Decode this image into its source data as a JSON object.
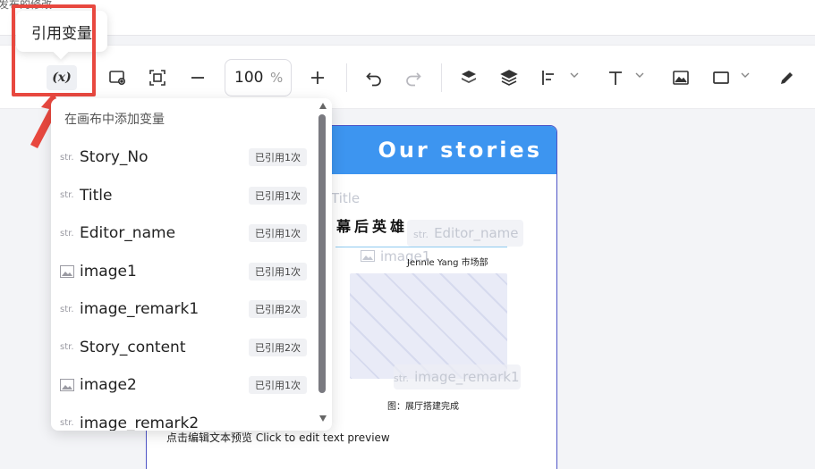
{
  "header": {
    "clipped_text": "发布的修改"
  },
  "tooltip": {
    "label": "引用变量"
  },
  "toolbar": {
    "variable_button_label": "(x)",
    "zoom_value": "100",
    "zoom_unit": "%"
  },
  "dropdown": {
    "heading": "在画布中添加变量",
    "items": [
      {
        "type": "str.",
        "name": "Story_No",
        "badge": "已引用1次"
      },
      {
        "type": "str.",
        "name": "Title",
        "badge": "已引用1次"
      },
      {
        "type": "str.",
        "name": "Editor_name",
        "badge": "已引用1次"
      },
      {
        "type": "image-icon",
        "name": "image1",
        "badge": "已引用1次"
      },
      {
        "type": "str.",
        "name": "image_remark1",
        "badge": "已引用2次"
      },
      {
        "type": "str.",
        "name": "Story_content",
        "badge": "已引用2次"
      },
      {
        "type": "image-icon",
        "name": "image2",
        "badge": "已引用1次"
      },
      {
        "type": "str.",
        "name": "image_remark2",
        "badge": ""
      }
    ]
  },
  "canvas": {
    "header_title": "Our stories",
    "ghost_title": "Title",
    "section_title": "幕后英雄",
    "ghost_editor_prefix": "str.",
    "ghost_editor": "Editor_name",
    "ghost_image": "image1",
    "author_line": "Jennie Yang 市场部",
    "ghost_remark_prefix": "str.",
    "ghost_remark": "image_remark1",
    "caption": "图：展厅搭建完成",
    "preview_text": "点击编辑文本预览 Click to edit text preview"
  },
  "colors": {
    "accent": "#3d95f0",
    "highlight": "#e8483f",
    "card_border": "#4f55c7"
  }
}
